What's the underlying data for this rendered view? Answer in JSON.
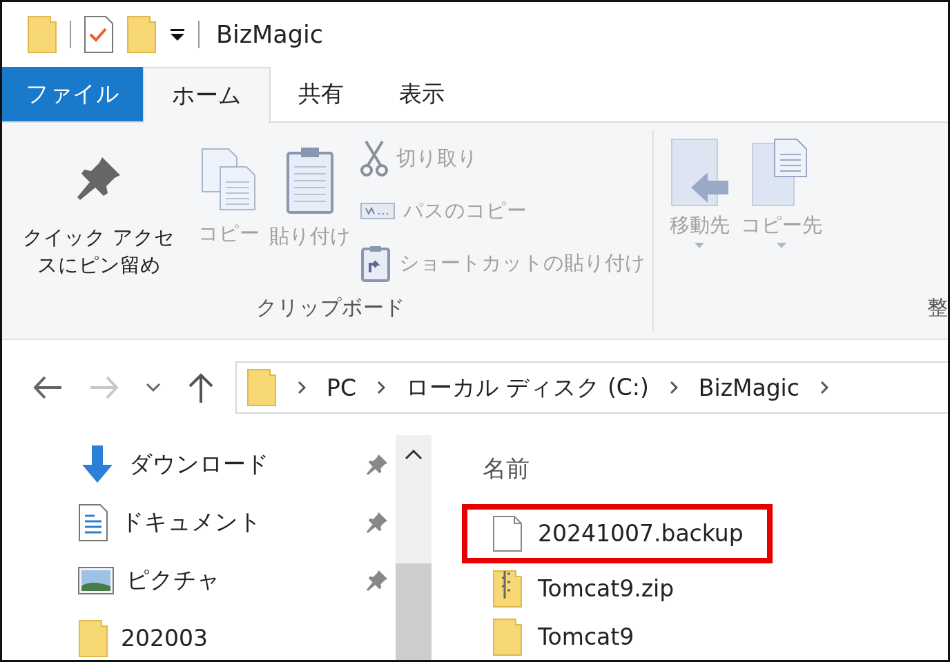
{
  "window": {
    "title": "BizMagic"
  },
  "tabs": [
    {
      "label": "ファイル",
      "kind": "file",
      "selected": false
    },
    {
      "label": "ホーム",
      "kind": "tab",
      "selected": true
    },
    {
      "label": "共有",
      "kind": "tab",
      "selected": false
    },
    {
      "label": "表示",
      "kind": "tab",
      "selected": false
    }
  ],
  "ribbon": {
    "clipboard": {
      "large": [
        {
          "label": "クイック アクセスにピン留め",
          "kind": "pin",
          "disabled": false
        },
        {
          "label": "コピー",
          "kind": "copy",
          "disabled": true
        },
        {
          "label": "貼り付け",
          "kind": "paste",
          "disabled": true
        }
      ],
      "small": [
        {
          "label": "切り取り",
          "kind": "cut",
          "disabled": true
        },
        {
          "label": "パスのコピー",
          "kind": "path",
          "disabled": true
        },
        {
          "label": "ショートカットの貼り付け",
          "kind": "shortcut",
          "disabled": true
        }
      ],
      "group_label": "クリップボード"
    },
    "organize": {
      "buttons": [
        {
          "label": "移動先",
          "kind": "move",
          "disabled": true
        },
        {
          "label": "コピー先",
          "kind": "copyto",
          "disabled": true
        }
      ],
      "group_label": "整"
    }
  },
  "address": {
    "back_disabled": false,
    "forward_disabled": true,
    "breadcrumbs": [
      "PC",
      "ローカル ディスク (C:)",
      "BizMagic"
    ]
  },
  "sidebar": {
    "items": [
      {
        "label": "ダウンロード",
        "kind": "download",
        "pinned": true
      },
      {
        "label": "ドキュメント",
        "kind": "document",
        "pinned": true
      },
      {
        "label": "ピクチャ",
        "kind": "picture",
        "pinned": true
      },
      {
        "label": "202003",
        "kind": "folder",
        "pinned": false
      }
    ]
  },
  "files": {
    "column": "名前",
    "items": [
      {
        "name": "20241007.backup",
        "kind": "file",
        "highlighted": true
      },
      {
        "name": "Tomcat9.zip",
        "kind": "zip",
        "highlighted": false
      },
      {
        "name": "Tomcat9",
        "kind": "folder",
        "highlighted": false
      }
    ]
  }
}
